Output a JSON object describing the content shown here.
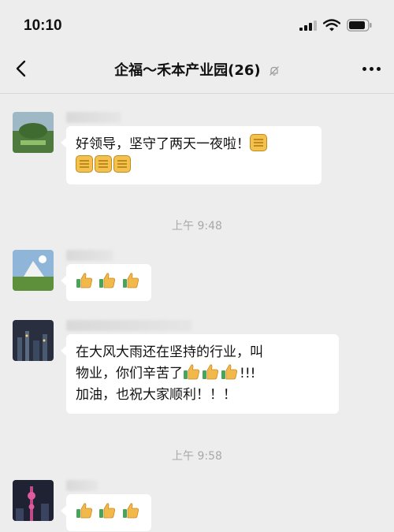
{
  "status_bar": {
    "time": "10:10"
  },
  "nav": {
    "title": "企福～禾本产业园(26)"
  },
  "messages": [
    {
      "text": "好领导，坚守了两天一夜啦！",
      "emoji": "fist-emoji"
    },
    {
      "timestamp": "上午 9:48",
      "emoji": "thumbs-up-emoji"
    },
    {
      "text_line1": "在大风大雨还在坚持的行业，叫",
      "text_line2_a": "物业，你们辛苦了",
      "text_line2_b": "!!!",
      "text_line3": "加油，也祝大家顺利！！！"
    },
    {
      "timestamp": "上午 9:58",
      "emoji": "thumbs-up-emoji"
    }
  ],
  "colors": {
    "background": "#ededed",
    "bubble": "#ffffff",
    "timestamp": "#a8a8a8"
  }
}
